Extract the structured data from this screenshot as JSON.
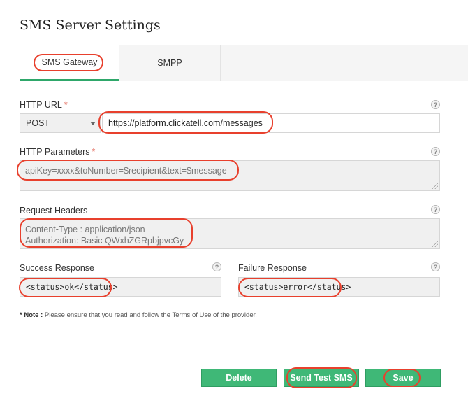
{
  "page": {
    "title": "SMS Server Settings"
  },
  "tabs": [
    {
      "label": "SMS Gateway",
      "active": true
    },
    {
      "label": "SMPP",
      "active": false
    }
  ],
  "form": {
    "http_url": {
      "label": "HTTP URL",
      "required_mark": "*",
      "method": "POST",
      "value": "https://platform.clickatell.com/messages"
    },
    "http_parameters": {
      "label": "HTTP Parameters",
      "required_mark": "*",
      "value": "apiKey=xxxx&toNumber=$recipient&text=$message"
    },
    "request_headers": {
      "label": "Request Headers",
      "lines": [
        "Content-Type : application/json",
        "Authorization: Basic QWxhZGRpbjpvcGy"
      ]
    },
    "success_response": {
      "label": "Success Response",
      "value": "<status>ok</status>"
    },
    "failure_response": {
      "label": "Failure Response",
      "value": "<status>error</status>"
    },
    "help_glyph": "?"
  },
  "note": {
    "prefix": "* Note :",
    "text": "Please ensure that you read and follow the Terms of Use of the provider."
  },
  "buttons": {
    "delete": "Delete",
    "send_test": "Send Test SMS",
    "save": "Save"
  },
  "colors": {
    "accent": "#3fb877",
    "annotation": "#e8402d",
    "required": "#e05a4a"
  }
}
